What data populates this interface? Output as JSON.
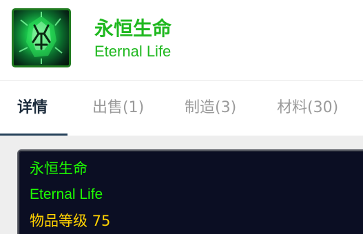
{
  "item": {
    "name_cn": "永恒生命",
    "name_en": "Eternal Life",
    "icon": "eternal-life-green-crystal-icon",
    "quality_color": "#1eff00"
  },
  "tabs": [
    {
      "label": "详情",
      "active": true
    },
    {
      "label": "出售(1)",
      "active": false
    },
    {
      "label": "制造(3)",
      "active": false
    },
    {
      "label": "材料(30)",
      "active": false
    }
  ],
  "tooltip": {
    "name_cn": "永恒生命",
    "name_en": "Eternal Life",
    "item_level": "物品等级 75"
  },
  "colors": {
    "title_green": "#1fb81f",
    "tooltip_bg": "#0b0e23",
    "item_level_gold": "#ffd100",
    "tab_active": "#1e2d3d",
    "tab_inactive": "#9a9a9a"
  }
}
